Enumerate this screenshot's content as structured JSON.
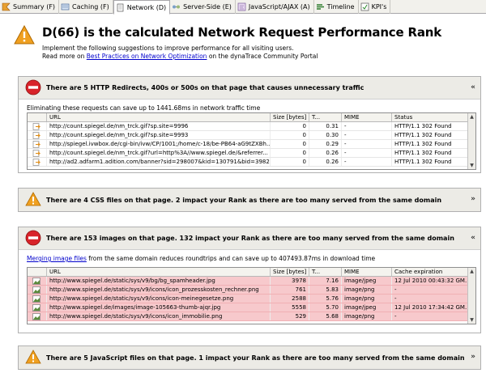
{
  "tabs": [
    {
      "label": "Summary (F)",
      "icon": "summary-icon",
      "active": false
    },
    {
      "label": "Caching (F)",
      "icon": "caching-icon",
      "active": false
    },
    {
      "label": "Network (D)",
      "icon": "network-icon",
      "active": true
    },
    {
      "label": "Server-Side (E)",
      "icon": "server-side-icon",
      "active": false
    },
    {
      "label": "JavaScript/AJAX (A)",
      "icon": "javascript-icon",
      "active": false
    },
    {
      "label": "Timeline",
      "icon": "timeline-icon",
      "active": false
    },
    {
      "label": "KPI's",
      "icon": "kpi-icon",
      "active": false
    }
  ],
  "header": {
    "title": "D(66) is the calculated Network Request Performance Rank",
    "line1": "Implement the following suggestions to improve performance for all visiting users.",
    "line2_prefix": "Read more on ",
    "line2_link": "Best Practices on Network Optimization",
    "line2_suffix": " on the dynaTrace Community Portal"
  },
  "redirects": {
    "title": "There are 5 HTTP Redirects, 400s or 500s on that page that causes unnecessary traffic",
    "savings": "Eliminating these requests can save up to 1441.68ms in network traffic time",
    "columns": [
      "URL",
      "Size [bytes]",
      "T...",
      "MIME",
      "Status"
    ],
    "rows": [
      {
        "url": "http://count.spiegel.de/nm_trck.gif?sp.site=9996",
        "size": "0",
        "time": "0.31",
        "mime": "-",
        "status": "HTTP/1.1 302 Found"
      },
      {
        "url": "http://count.spiegel.de/nm_trck.gif?sp.site=9993",
        "size": "0",
        "time": "0.30",
        "mime": "-",
        "status": "HTTP/1.1 302 Found"
      },
      {
        "url": "http://spiegel.ivwbox.de/cgi-bin/ivw/CP/1001;/home/c-18/be-PB64-aG9tZXBh...",
        "size": "0",
        "time": "0.29",
        "mime": "-",
        "status": "HTTP/1.1 302 Found"
      },
      {
        "url": "http://count.spiegel.de/nm_trck.gif?url=http%3A//www.spiegel.de/&referrer...",
        "size": "0",
        "time": "0.26",
        "mime": "-",
        "status": "HTTP/1.1 302 Found"
      },
      {
        "url": "http://ad2.adfarm1.adition.com/banner?sid=298007&kid=130791&bid=3982...",
        "size": "0",
        "time": "0.26",
        "mime": "-",
        "status": "HTTP/1.1 302 Found"
      }
    ]
  },
  "css": {
    "title": "There are 4 CSS files on that page. 2 impact your Rank as there are too many served from the same domain"
  },
  "images": {
    "title": "There are 153 images on that page. 132 impact your Rank as there are too many served from the same domain",
    "link": "Merging image files",
    "savings": " from the same domain reduces roundtrips and can save up to 407493.87ms in download time",
    "columns": [
      "URL",
      "Size [bytes]",
      "T...",
      "MIME",
      "Cache expiration"
    ],
    "rows": [
      {
        "url": "http://www.spiegel.de/static/sys/v9/bg/bg_spamheader.jpg",
        "size": "3978",
        "time": "7.16",
        "mime": "image/jpeg",
        "cache": "12 Jul 2010 00:43:32 GM..."
      },
      {
        "url": "http://www.spiegel.de/static/sys/v9/icons/icon_prozesskosten_rechner.png",
        "size": "761",
        "time": "5.83",
        "mime": "image/png",
        "cache": "-"
      },
      {
        "url": "http://www.spiegel.de/static/sys/v9/icons/icon-meinegesetze.png",
        "size": "2588",
        "time": "5.76",
        "mime": "image/png",
        "cache": "-"
      },
      {
        "url": "http://www.spiegel.de/images/image-105663-thumb-ajqr.jpg",
        "size": "5558",
        "time": "5.70",
        "mime": "image/jpeg",
        "cache": "12 Jul 2010 17:34:42 GM..."
      },
      {
        "url": "http://www.spiegel.de/static/sys/v9/icons/icon_immobilie.png",
        "size": "529",
        "time": "5.68",
        "mime": "image/png",
        "cache": "-"
      }
    ]
  },
  "javascript": {
    "title": "There are 5 JavaScript files on that page. 1 impact your Rank as there are too many served from the same domain"
  },
  "colors": {
    "warning": "#f0a020",
    "error": "#d8232a",
    "row_highlight": "#f7c9cc",
    "link": "#0000cc"
  }
}
